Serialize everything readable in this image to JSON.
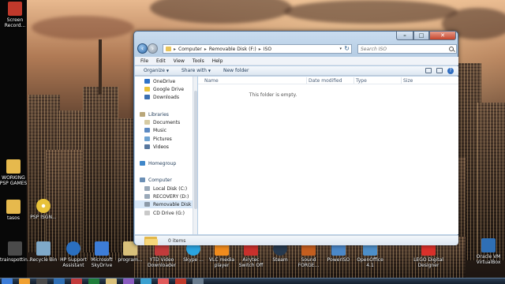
{
  "desktop": {
    "icons": [
      {
        "id": "screen-recorder",
        "label": "Screen Record...",
        "color": "#c0392b"
      },
      {
        "id": "working-psp-games",
        "label": "WORKING PSP GAMES",
        "color": "#e6b94d"
      },
      {
        "id": "tasos",
        "label": "tasos",
        "color": "#e6b94d"
      },
      {
        "id": "disk-image",
        "label": "PSP ISGN...",
        "color": "#e8c23a"
      },
      {
        "id": "trainspotting",
        "label": "trainspottin...",
        "color": "#4a4a4a"
      },
      {
        "id": "recycle-bin",
        "label": "Recycle Bin",
        "color": "#7fa9c9"
      },
      {
        "id": "hp-support-assistant",
        "label": "HP Support Assistant",
        "color": "#2a6fc0"
      },
      {
        "id": "microsoft-skydrive",
        "label": "Microsoft SkyDrive",
        "color": "#3d7dd8"
      },
      {
        "id": "programs",
        "label": "program...",
        "color": "#d9c07a"
      },
      {
        "id": "ytd-video-downloader",
        "label": "YTD Video Downloader",
        "color": "#c23b3b"
      },
      {
        "id": "skype",
        "label": "Skype ...",
        "color": "#2aa4e0"
      },
      {
        "id": "vlc-media-player",
        "label": "VLC media player",
        "color": "#f08b1d"
      },
      {
        "id": "airytec-switch-off",
        "label": "Airytec Switch Off",
        "color": "#c9302c"
      },
      {
        "id": "steam",
        "label": "Steam",
        "color": "#26394e"
      },
      {
        "id": "sound-forge",
        "label": "Sound FORGE...",
        "color": "#c45e1f"
      },
      {
        "id": "poweriso",
        "label": "PowerISO",
        "color": "#4b88c8"
      },
      {
        "id": "openoffice",
        "label": "OpenOffice 4.1",
        "color": "#4d8fc9"
      },
      {
        "id": "lego-digital-designer",
        "label": "LEGO Digital Designer",
        "color": "#d9302a"
      },
      {
        "id": "oracle-vm-virtualbox",
        "label": "Oracle VM VirtualBox",
        "color": "#2f6fb5"
      }
    ]
  },
  "window": {
    "address": {
      "crumbs": [
        "Computer",
        "Removable Disk (F:)",
        "ISO"
      ],
      "separator": "▸"
    },
    "search_placeholder": "Search ISO",
    "menu": [
      "File",
      "Edit",
      "View",
      "Tools",
      "Help"
    ],
    "commands": {
      "organize": "Organize",
      "share_with": "Share with",
      "new_folder": "New folder"
    },
    "nav_items": [
      {
        "label": "OneDrive",
        "color": "#2f73c8",
        "type": "item"
      },
      {
        "label": "Google Drive",
        "color": "#e8c23a",
        "type": "item"
      },
      {
        "label": "Downloads",
        "color": "#3b6fb0",
        "type": "item"
      },
      {
        "label": "Libraries",
        "color": "#b9a77a",
        "type": "group"
      },
      {
        "label": "Documents",
        "color": "#d6cba3",
        "type": "item"
      },
      {
        "label": "Music",
        "color": "#5d8ac2",
        "type": "item"
      },
      {
        "label": "Pictures",
        "color": "#6ea3d2",
        "type": "item"
      },
      {
        "label": "Videos",
        "color": "#58779e",
        "type": "item"
      },
      {
        "label": "Homegroup",
        "color": "#3f87c9",
        "type": "group"
      },
      {
        "label": "Computer",
        "color": "#6b8fb5",
        "type": "group"
      },
      {
        "label": "Local Disk (C:)",
        "color": "#9aa9b9",
        "type": "item"
      },
      {
        "label": "RECOVERY (D:)",
        "color": "#9aa9b9",
        "type": "item"
      },
      {
        "label": "Removable Disk",
        "color": "#8c9aa8",
        "type": "item",
        "selected": true
      },
      {
        "label": "CD Drive (G:)",
        "color": "#c9c9c9",
        "type": "item"
      }
    ],
    "columns": [
      "Name",
      "Date modified",
      "Type",
      "Size"
    ],
    "empty_message": "This folder is empty.",
    "status": "0 items",
    "buttons": {
      "minimize": "–",
      "maximize": "□",
      "close": "✕"
    }
  },
  "taskbar": {
    "items": [
      "#3d7dd8",
      "#f0a030",
      "#4a4a4a",
      "#2f6fb5",
      "#c23b3b",
      "#1f7e3a",
      "#d9c07a",
      "#8a5bbf",
      "#3aa0d0",
      "#e05a5a",
      "#c0392b",
      "#6a7c8e"
    ]
  },
  "colors": {
    "window_border": "#4a6b8f",
    "close_red": "#c4442c",
    "selection": "#d8e8f8"
  }
}
